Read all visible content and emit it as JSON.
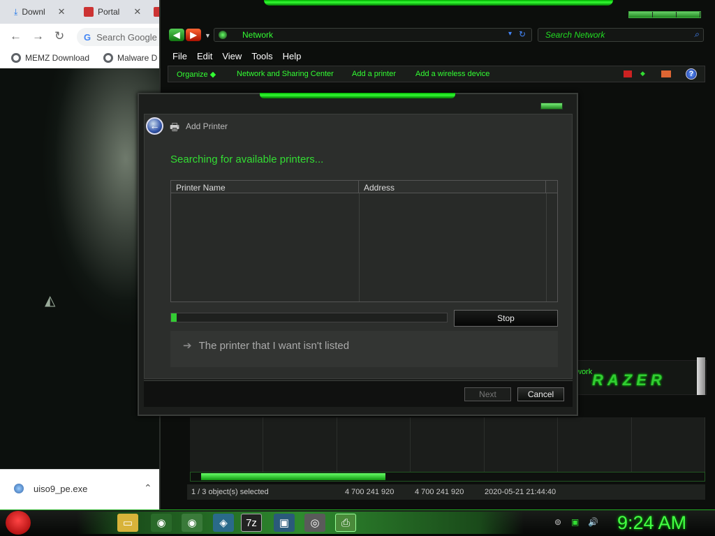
{
  "browser": {
    "tabs": [
      {
        "label": "Downl",
        "icon": "download-icon"
      },
      {
        "label": "Portal",
        "icon": "portal-favicon"
      }
    ],
    "search_placeholder": "Search Google",
    "bookmarks": [
      {
        "label": "MEMZ Download",
        "icon": "globe-icon"
      },
      {
        "label": "Malware D",
        "icon": "globe-icon"
      }
    ],
    "download": {
      "filename": "uiso9_pe.exe"
    }
  },
  "explorer": {
    "address": "Network",
    "search_placeholder": "Search Network",
    "menu": [
      "File",
      "Edit",
      "View",
      "Tools",
      "Help"
    ],
    "commands": [
      "Organize",
      "Network and Sharing Center",
      "Add a printer",
      "Add a wireless device"
    ],
    "side_label": "work",
    "brand": "RAZER",
    "status": {
      "selected": "1 / 3 object(s) selected",
      "size1": "4 700 241 920",
      "size2": "4 700 241 920",
      "date": "2020-05-21 21:44:40"
    }
  },
  "dialog": {
    "title": "Add Printer",
    "heading": "Searching for available printers...",
    "columns": [
      "Printer Name",
      "Address"
    ],
    "stop_label": "Stop",
    "not_listed": "The printer that I want isn't listed",
    "next_label": "Next",
    "cancel_label": "Cancel"
  },
  "taskbar": {
    "apps": [
      "explorer-icon",
      "chrome-icon",
      "chrome-alt-icon",
      "network-icon",
      "7zip-icon",
      "window-icon",
      "disc-icon",
      "printer-icon"
    ],
    "clock": "9:24 AM"
  },
  "colors": {
    "accent": "#33dd33",
    "background": "#0c0e0c"
  }
}
